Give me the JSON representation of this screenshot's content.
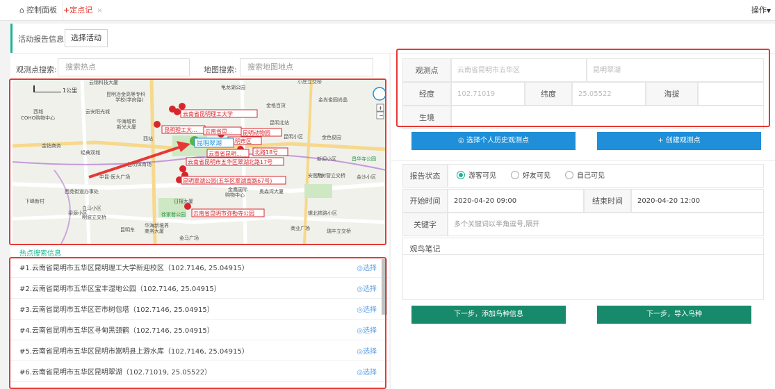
{
  "tabs": {
    "home": {
      "icon": "home-icon",
      "label": "控制面板"
    },
    "active": {
      "icon": "plus-icon",
      "label": "定点记",
      "close": "×"
    },
    "ops": "操作"
  },
  "header": {
    "title": "活动报告信息",
    "select_button": "选择活动"
  },
  "search": {
    "obs_label": "观测点搜索:",
    "obs_placeholder": "搜索热点",
    "map_label": "地图搜索:",
    "map_placeholder": "搜索地图地点"
  },
  "map": {
    "scale": "1公里",
    "pois": [
      "云锦科技大厦",
      "昆明冶金高等专科学校(学府路)",
      "龟龙湖公园",
      "金格百货",
      "小庄立交桥",
      "金尚俊园尚晶",
      "西城COHO购物中心",
      "云安阳光城",
      "华海城市新光大厦",
      "昆明北站",
      "昆明小区",
      "金色俊园",
      "西站",
      "金钻商务",
      "经典双城",
      "昆明体育场",
      "金园小区",
      "昌华寺公园",
      "中昆·医大广场",
      "大树营立交桥",
      "金沙小区",
      "西苑街道办事处",
      "下峰新村",
      "日报大厦",
      "金鹰国际购物中心",
      "奥森湾大厦",
      "白马小区",
      "梁源小区",
      "明波立交桥",
      "昆明东",
      "华海新境界商务大厦",
      "徐家巷公园",
      "螺北铁路小区",
      "商业广场",
      "瑞丰立交桥",
      "安医院",
      "金马广场"
    ],
    "labels": [
      "云南省昆明理工大学",
      "昆明理工大...",
      "云南省昆...",
      "昆明动物园",
      "昆明翠湖",
      "昆明市区",
      "云南省昆明...",
      "北路18号",
      "云南省昆明市五华区翠湖北路17号",
      "昆明翠湖公园(五华区翠湖南路67号)",
      "云南省昆明市弥勒寺公园"
    ]
  },
  "hot": {
    "title": "热点搜索信息",
    "items": [
      {
        "text": "#1.云南省昆明市五华区昆明理工大学新迎校区（102.7146, 25.04915）",
        "select": "◎选择"
      },
      {
        "text": "#2.云南省昆明市五华区宝丰湿地公园（102.7146, 25.04915）",
        "select": "◎选择"
      },
      {
        "text": "#3.云南省昆明市五华区芒市树包塔（102.7146, 25.04915）",
        "select": "◎选择"
      },
      {
        "text": "#4.云南省昆明市五华区寻甸黑颈鹤（102.7146, 25.04915）",
        "select": "◎选择"
      },
      {
        "text": "#5.云南省昆明市五华区昆明市嵩明县上游水库（102.7146, 25.04915）",
        "select": "◎选择"
      },
      {
        "text": "#6.云南省昆明市五华区昆明翠湖（102.71019, 25.05522）",
        "select": "◎选择"
      }
    ]
  },
  "obs": {
    "label": "观测点",
    "region": "云南省昆明市五华区",
    "name": "昆明翠湖",
    "lng_label": "经度",
    "lng": "102.71019",
    "lat_label": "纬度",
    "lat": "25.05522",
    "alt_label": "海拔",
    "alt": "",
    "habitat_label": "生境",
    "habitat": ""
  },
  "buttons": {
    "history": "◎ 选择个人历史观测点",
    "create": "+ 创建观测点",
    "next_add": "下一步，添加鸟种信息",
    "next_import": "下一步，导入鸟种"
  },
  "report": {
    "status_label": "报告状态",
    "options": [
      "游客可见",
      "好友可见",
      "自己可见"
    ],
    "selected_index": 0,
    "start_label": "开始时间",
    "start": "2020-04-20 09:00",
    "end_label": "结束时间",
    "end": "2020-04-20 12:00",
    "keyword_label": "关键字",
    "keyword_placeholder": "多个关键词以半角逗号,隔开",
    "notes_label": "观鸟笔记"
  },
  "colors": {
    "accent": "#1ab394",
    "highlight": "#e53935",
    "primary": "#1e8fd8",
    "dark_green": "#168a6a"
  }
}
